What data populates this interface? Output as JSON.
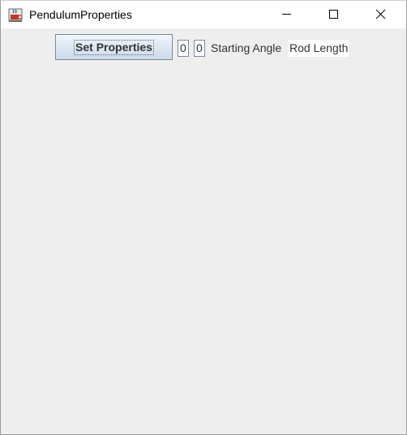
{
  "window": {
    "title": "PendulumProperties",
    "app_icon": "java-coffee-cup-icon",
    "controls": {
      "minimize": "minimize-icon",
      "maximize": "maximize-icon",
      "close": "close-icon"
    }
  },
  "toolbar": {
    "set_button_label": "Set Properties",
    "angle_value": "0",
    "length_value": "0",
    "angle_label": "Starting Angle",
    "length_label": "Rod Length"
  }
}
